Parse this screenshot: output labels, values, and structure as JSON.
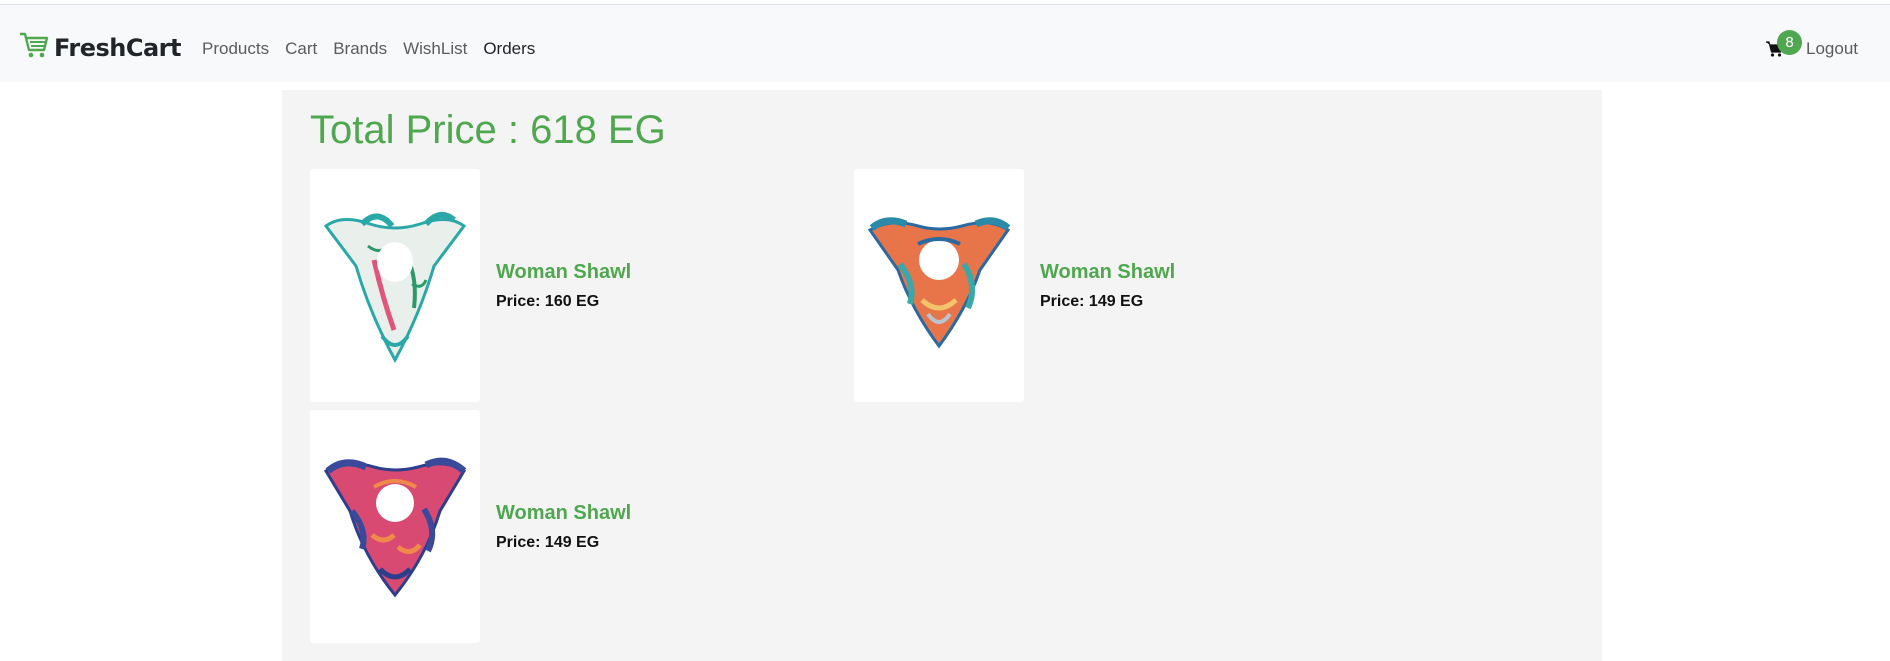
{
  "navbar": {
    "brand": "FreshCart",
    "links": [
      "Products",
      "Cart",
      "Brands",
      "WishList",
      "Orders"
    ],
    "cart_count": "8",
    "logout": "Logout"
  },
  "cart": {
    "total_label": "Total Price : 618 EG",
    "items": [
      {
        "name": "Woman Shawl",
        "price": "Price: 160 EG"
      },
      {
        "name": "Woman Shawl",
        "price": "Price: 149 EG"
      },
      {
        "name": "Woman Shawl",
        "price": "Price: 149 EG"
      }
    ]
  },
  "colors": {
    "accent": "#4fa74f",
    "navbar_bg": "#f8f9fa",
    "panel_bg": "#f4f4f4"
  },
  "icons": [
    "cart-logo-icon",
    "cart-icon"
  ]
}
